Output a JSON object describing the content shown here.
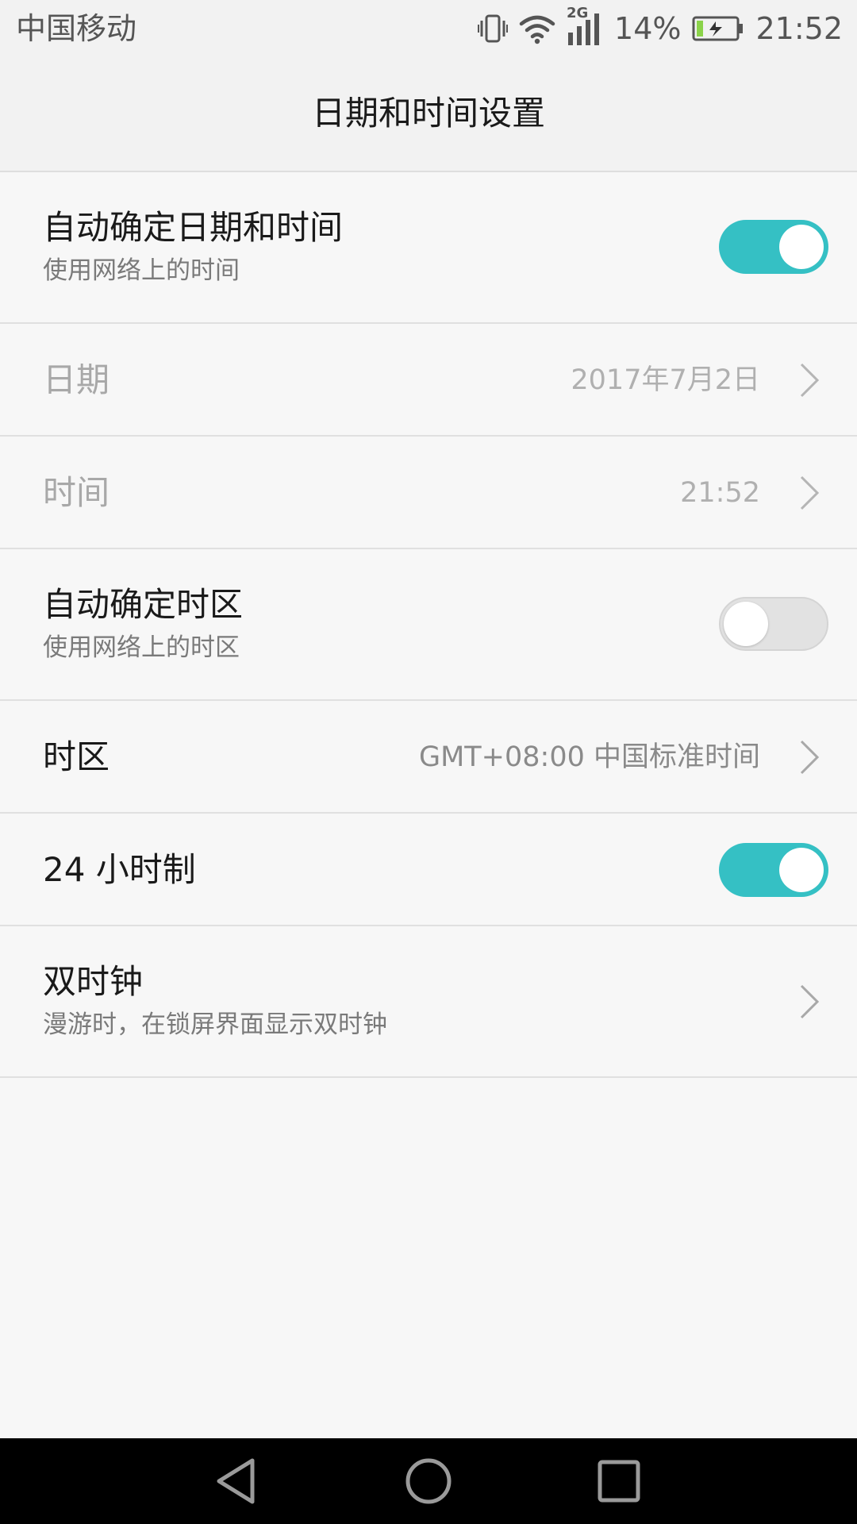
{
  "status_bar": {
    "carrier": "中国移动",
    "network_type": "2G",
    "battery_percent": "14%",
    "time": "21:52",
    "icons": [
      "vibrate-icon",
      "wifi-icon",
      "cellular-signal-icon",
      "battery-charging-icon"
    ]
  },
  "header": {
    "title": "日期和时间设置"
  },
  "settings": {
    "auto_datetime": {
      "title": "自动确定日期和时间",
      "subtitle": "使用网络上的时间",
      "enabled": true
    },
    "date": {
      "title": "日期",
      "value": "2017年7月2日"
    },
    "time": {
      "title": "时间",
      "value": "21:52"
    },
    "auto_timezone": {
      "title": "自动确定时区",
      "subtitle": "使用网络上的时区",
      "enabled": false
    },
    "timezone": {
      "title": "时区",
      "value": "GMT+08:00 中国标准时间"
    },
    "hour24": {
      "title": "24 小时制",
      "enabled": true
    },
    "dual_clock": {
      "title": "双时钟",
      "subtitle": "漫游时，在锁屏界面显示双时钟"
    }
  },
  "colors": {
    "accent": "#35c0c4",
    "toggle_off": "#e2e2e2",
    "background": "#f7f7f7",
    "nav_bar": "#000000"
  },
  "nav": {
    "icons": [
      "back-icon",
      "home-icon",
      "recents-icon"
    ]
  }
}
